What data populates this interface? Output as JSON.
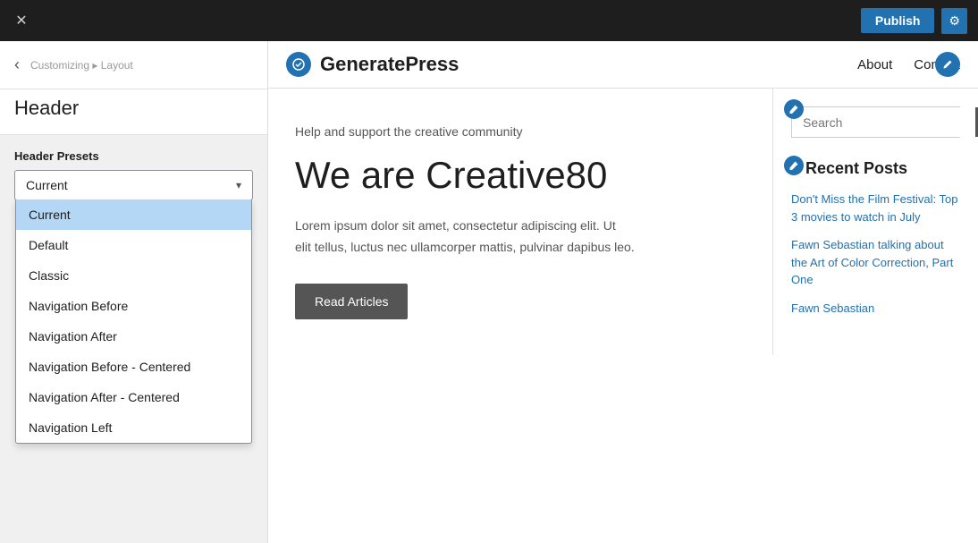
{
  "toolbar": {
    "close_label": "✕",
    "publish_label": "Publish",
    "gear_label": "⚙"
  },
  "sidebar": {
    "back_label": "‹",
    "breadcrumb_main": "Customizing",
    "breadcrumb_sep": "▸",
    "breadcrumb_sub": "Layout",
    "section_title": "Header",
    "header_presets_label": "Header Presets",
    "select_current": "Current",
    "select_arrow": "▾",
    "dropdown_items": [
      {
        "label": "Current",
        "active": true
      },
      {
        "label": "Default",
        "active": false
      },
      {
        "label": "Classic",
        "active": false
      },
      {
        "label": "Navigation Before",
        "active": false
      },
      {
        "label": "Navigation After",
        "active": false
      },
      {
        "label": "Navigation Before - Centered",
        "active": false
      },
      {
        "label": "Navigation After - Centered",
        "active": false
      },
      {
        "label": "Navigation Left",
        "active": false
      }
    ]
  },
  "preview": {
    "site_name": "GeneratePress",
    "logo_text": "✎",
    "edit_icon": "✎",
    "nav_links": [
      "About",
      "Contact"
    ],
    "hero_subtitle": "Help and support the creative community",
    "hero_title": "We are Creative80",
    "hero_body": "Lorem ipsum dolor sit amet, consectetur adipiscing elit. Ut elit tellus, luctus nec ullamcorper mattis, pulvinar dapibus leo.",
    "read_articles_btn": "Read Articles",
    "search_placeholder": "Search",
    "search_btn": "🔍",
    "recent_posts_title": "Recent Posts",
    "recent_posts": [
      "Don't Miss the Film Festival: Top 3 movies to watch in July",
      "Fawn Sebastian talking about the Art of Color Correction, Part One",
      "Fawn Sebastian"
    ]
  }
}
